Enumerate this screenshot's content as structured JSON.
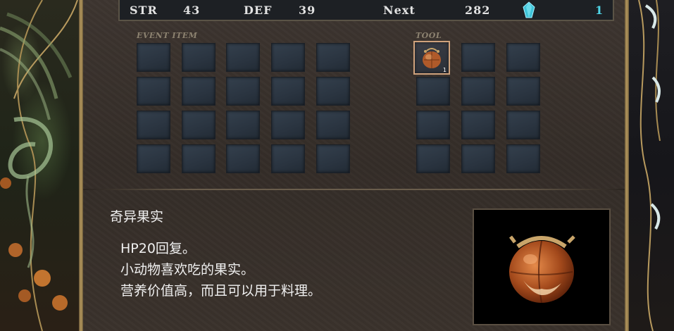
{
  "stats": {
    "str_label": "STR",
    "str_value": "43",
    "def_label": "DEF",
    "def_value": "39",
    "next_label": "Next",
    "next_value": "282",
    "gem_icon": "crystal-icon",
    "gem_count": "1"
  },
  "sections": {
    "event_item_label": "EVENT ITEM",
    "tool_label": "TOOL"
  },
  "tool_items": [
    {
      "icon": "strange-fruit-icon",
      "count": "1",
      "selected": true
    }
  ],
  "description": {
    "title": "奇异果实",
    "lines": [
      "HP20回复。",
      "小动物喜欢吃的果实。",
      "营养价值高，而且可以用于料理。"
    ]
  },
  "colors": {
    "panel_bg": "#3a322c",
    "slot_bg": "#2a3440",
    "accent_cyan": "#4fd6e8",
    "selected_border": "#cfa27c"
  }
}
